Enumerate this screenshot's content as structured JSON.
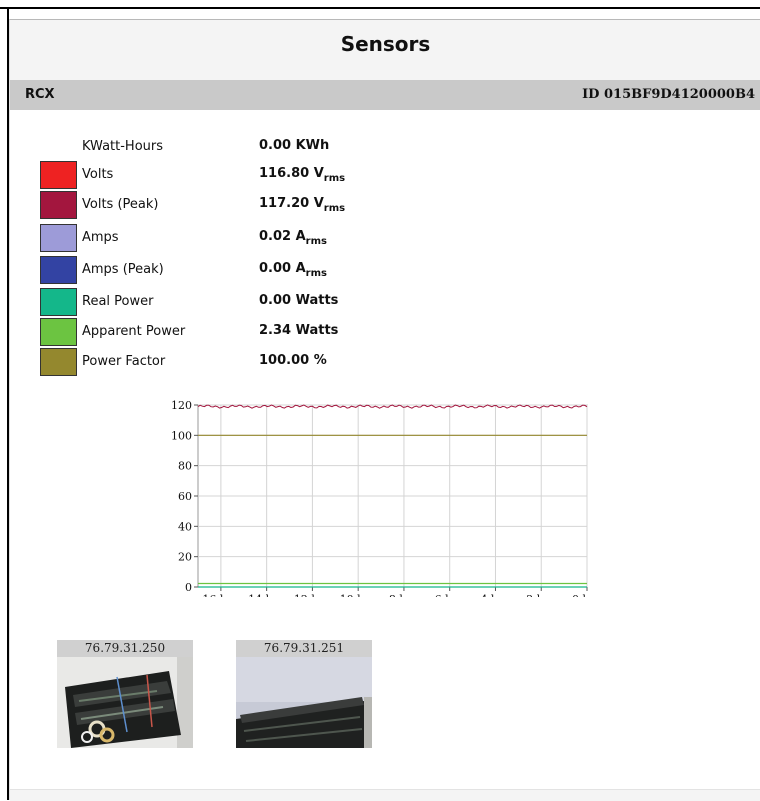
{
  "page": {
    "title": "Sensors"
  },
  "header": {
    "name": "RCX",
    "id": "ID 015BF9D4120000B4"
  },
  "sensors": [
    {
      "label": "KWatt-Hours",
      "value": "0.00 KWh",
      "unit_sub": "",
      "color": ""
    },
    {
      "label": "Volts",
      "value": "116.80 V",
      "unit_sub": "rms",
      "color": "#ee2222"
    },
    {
      "label": "Volts (Peak)",
      "value": "117.20 V",
      "unit_sub": "rms",
      "color": "#a3163e"
    },
    {
      "label": "Amps",
      "value": "0.02 A",
      "unit_sub": "rms",
      "color": "#9d9bd8"
    },
    {
      "label": "Amps (Peak)",
      "value": "0.00 A",
      "unit_sub": "rms",
      "color": "#3343a3"
    },
    {
      "label": "Real Power",
      "value": "0.00 Watts",
      "unit_sub": "",
      "color": "#14b78a"
    },
    {
      "label": "Apparent Power",
      "value": "2.34 Watts",
      "unit_sub": "",
      "color": "#6cc441"
    },
    {
      "label": "Power Factor",
      "value": "100.00 %",
      "unit_sub": "",
      "color": "#94882e"
    }
  ],
  "chart_data": {
    "type": "line",
    "x_ticks": [
      "16d",
      "14d",
      "12d",
      "10d",
      "8d",
      "6d",
      "4d",
      "2d",
      "0d"
    ],
    "x": [
      17,
      0
    ],
    "y_ticks": [
      "0",
      "20",
      "40",
      "60",
      "80",
      "100",
      "120"
    ],
    "ylim": [
      0,
      120
    ],
    "grid": true,
    "series": [
      {
        "color": "#a3163e",
        "x": [
          17,
          0
        ],
        "y": [
          119,
          119
        ]
      },
      {
        "color": "#94882e",
        "x": [
          17,
          0
        ],
        "y": [
          100,
          100
        ]
      },
      {
        "color": "#6cc441",
        "x": [
          17,
          0
        ],
        "y": [
          2.3,
          2.3
        ]
      },
      {
        "color": "#14b78a",
        "x": [
          17,
          0
        ],
        "y": [
          0,
          0
        ]
      }
    ]
  },
  "cameras": [
    {
      "label": "76.79.31.250"
    },
    {
      "label": "76.79.31.251"
    }
  ]
}
